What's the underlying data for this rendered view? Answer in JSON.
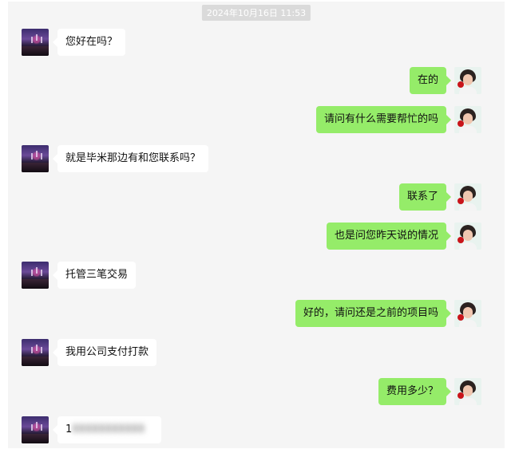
{
  "timestamp": "2024年10月16日 11:53",
  "messages": [
    {
      "side": "in",
      "text": "您好在吗？"
    },
    {
      "side": "out",
      "text": "在的"
    },
    {
      "side": "out",
      "text": "请问有什么需要帮忙的吗"
    },
    {
      "side": "in",
      "text": "就是毕米那边有和您联系吗？"
    },
    {
      "side": "out",
      "text": "联系了"
    },
    {
      "side": "out",
      "text": "也是问您昨天说的情况"
    },
    {
      "side": "in",
      "text": "托管三笔交易"
    },
    {
      "side": "out",
      "text": "好的，请问还是之前的项目吗"
    },
    {
      "side": "in",
      "text": "我用公司支付打款"
    },
    {
      "side": "out",
      "text": "费用多少？"
    },
    {
      "side": "in",
      "text": "1"
    }
  ],
  "avatars": {
    "incoming": "night-scene-avatar",
    "outgoing": "portrait-with-rose-avatar"
  },
  "colors": {
    "chat_background": "#f5f5f5",
    "incoming_bubble": "#ffffff",
    "outgoing_bubble": "#95ec69",
    "timestamp_badge": "#dadada"
  }
}
